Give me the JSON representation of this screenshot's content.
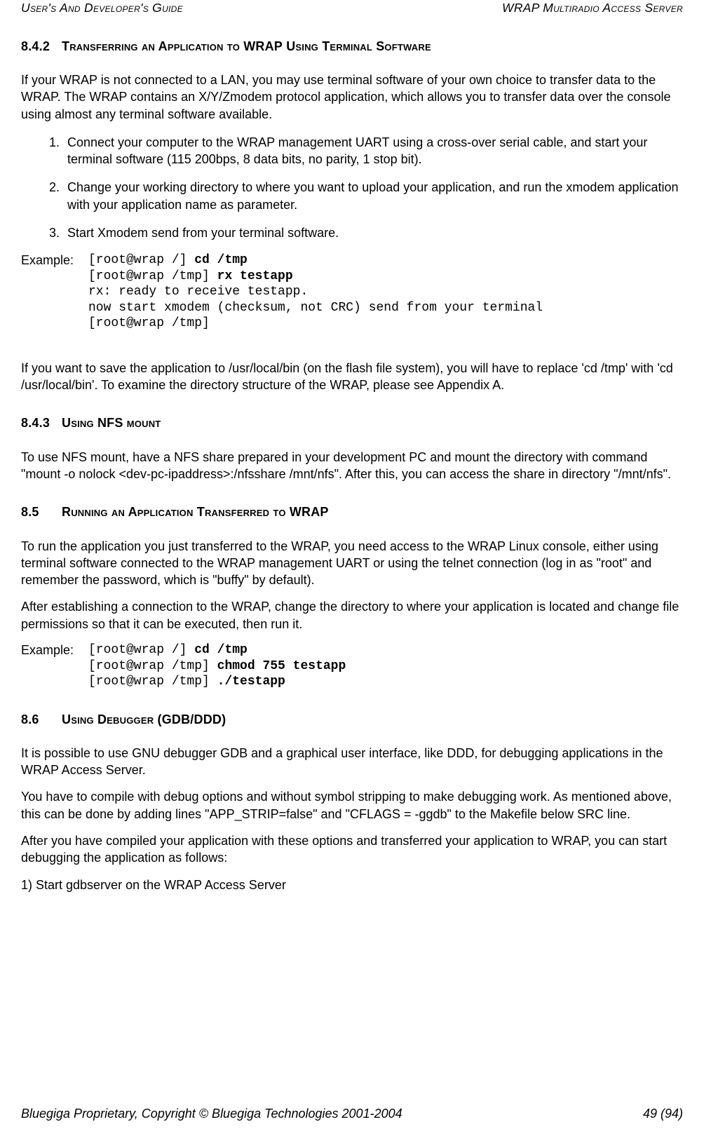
{
  "header": {
    "left": "User's And Developer's Guide",
    "right": "WRAP Multiradio Access Server"
  },
  "s842": {
    "num": "8.4.2",
    "title_pre": "Transferring an Application to ",
    "title_wrap": "WRAP",
    "title_post": " Using Terminal Software",
    "intro": "If your WRAP is not connected to a LAN, you may use terminal software of your own choice to transfer data to the WRAP. The WRAP contains an X/Y/Zmodem protocol application, which allows you to transfer data over the console using almost any terminal software available.",
    "steps": [
      "Connect your computer to the WRAP management UART using a cross-over serial cable, and start your terminal software (115 200bps, 8 data bits, no parity, 1 stop bit).",
      "Change your working directory to where you want to upload your application, and run the xmodem application with your application name as parameter.",
      "Start Xmodem send from your terminal software."
    ],
    "example_label": "Example:",
    "code": {
      "l1_prompt": "[root@wrap /] ",
      "l1_cmd": "cd /tmp",
      "l2_prompt": "[root@wrap /tmp] ",
      "l2_cmd": "rx testapp",
      "l3": "rx: ready to receive testapp.",
      "l4": "now start xmodem (checksum, not CRC) send from your terminal",
      "l5": "[root@wrap /tmp]"
    },
    "after": "If you want to save the application to /usr/local/bin (on the flash file system), you will have to replace 'cd /tmp' with 'cd /usr/local/bin'. To examine the directory structure of the WRAP, please see Appendix A."
  },
  "s843": {
    "num": "8.4.3",
    "title": "Using NFS mount",
    "body": "To use NFS mount, have a NFS share prepared in your development PC and mount the directory with command \"mount -o nolock <dev-pc-ipaddress>:/nfsshare /mnt/nfs\". After this, you can access the share in directory \"/mnt/nfs\"."
  },
  "s85": {
    "num": "8.5",
    "title_pre": "Running an Application Transferred to ",
    "title_wrap": "WRAP",
    "p1": "To run the application you just transferred to the WRAP, you need access to the WRAP Linux console, either using terminal software connected to the WRAP management UART or using the telnet connection (log in as \"root\" and remember the password, which is \"buffy\" by default).",
    "p2": "After establishing a connection to the WRAP, change the directory to where your application is located and change file permissions so that it can be executed, then run it.",
    "example_label": "Example:",
    "code": {
      "l1_prompt": "[root@wrap /] ",
      "l1_cmd": "cd /tmp",
      "l2_prompt": "[root@wrap /tmp] ",
      "l2_cmd": "chmod 755 testapp",
      "l3_prompt": "[root@wrap /tmp] ",
      "l3_cmd": "./testapp"
    }
  },
  "s86": {
    "num": "8.6",
    "title_pre": "Using Debugger ",
    "title_paren": "(GDB/DDD)",
    "p1": "It is possible to use GNU debugger GDB and a graphical user interface, like DDD, for debugging applications in the WRAP Access Server.",
    "p2": "You have to compile with debug options and without symbol stripping to make debugging work. As mentioned above, this can be done by adding lines \"APP_STRIP=false\" and \"CFLAGS = -ggdb\" to the Makefile below SRC line.",
    "p3": "After you have compiled your application with these options and transferred your application to WRAP, you can start debugging the application as follows:",
    "p4": "1) Start gdbserver on the WRAP Access Server"
  },
  "footer": {
    "left": "Bluegiga Proprietary, Copyright © Bluegiga Technologies 2001-2004",
    "right": "49 (94)"
  }
}
